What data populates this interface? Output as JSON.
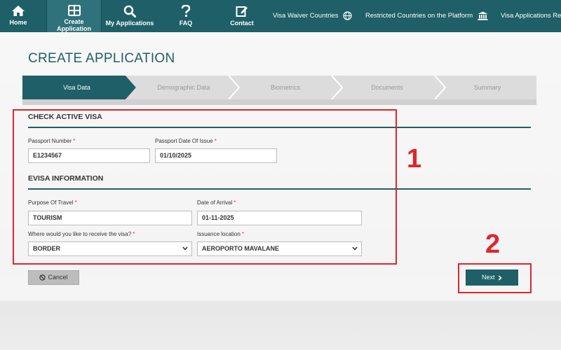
{
  "nav": {
    "items": [
      {
        "label": "Home",
        "icon": "home-icon"
      },
      {
        "label": "Create Application",
        "icon": "grid-icon",
        "active": true
      },
      {
        "label": "My Applications",
        "icon": "search-icon"
      },
      {
        "label": "FAQ",
        "icon": "question-icon"
      },
      {
        "label": "Contact",
        "icon": "edit-icon"
      }
    ],
    "right": [
      {
        "label": "Visa Waiver Countries",
        "icon": "globe-icon"
      },
      {
        "label": "Restricted Countries on the Platform",
        "icon": "bank-icon"
      },
      {
        "label": "Visa Applications Rec"
      }
    ]
  },
  "page": {
    "title": "CREATE APPLICATION"
  },
  "steps": [
    "Visa Data",
    "Demographic Data",
    "Biometrics",
    "Documents",
    "Summary"
  ],
  "check_visa": {
    "title": "CHECK ACTIVE VISA",
    "passport_number_label": "Passport Number",
    "passport_number_value": "E1234567",
    "passport_date_label": "Passport Date Of Issue",
    "passport_date_value": "01/10/2025"
  },
  "evisa": {
    "title": "EVISA INFORMATION",
    "purpose_label": "Purpose Of Travel",
    "purpose_value": "TOURISM",
    "arrival_label": "Date of Arrival",
    "arrival_value": "01-11-2025",
    "receive_label": "Where would you like to receive the visa?",
    "receive_value": "BORDER",
    "issuance_label": "Issuance location",
    "issuance_value": "AEROPORTO MAVALANE"
  },
  "required_marker": "*",
  "actions": {
    "cancel": "Cancel",
    "next": "Next"
  },
  "annotations": {
    "one": "1",
    "two": "2"
  },
  "colors": {
    "brand": "#1f5f68",
    "annotation": "#e0252c",
    "required": "#d9302b"
  }
}
